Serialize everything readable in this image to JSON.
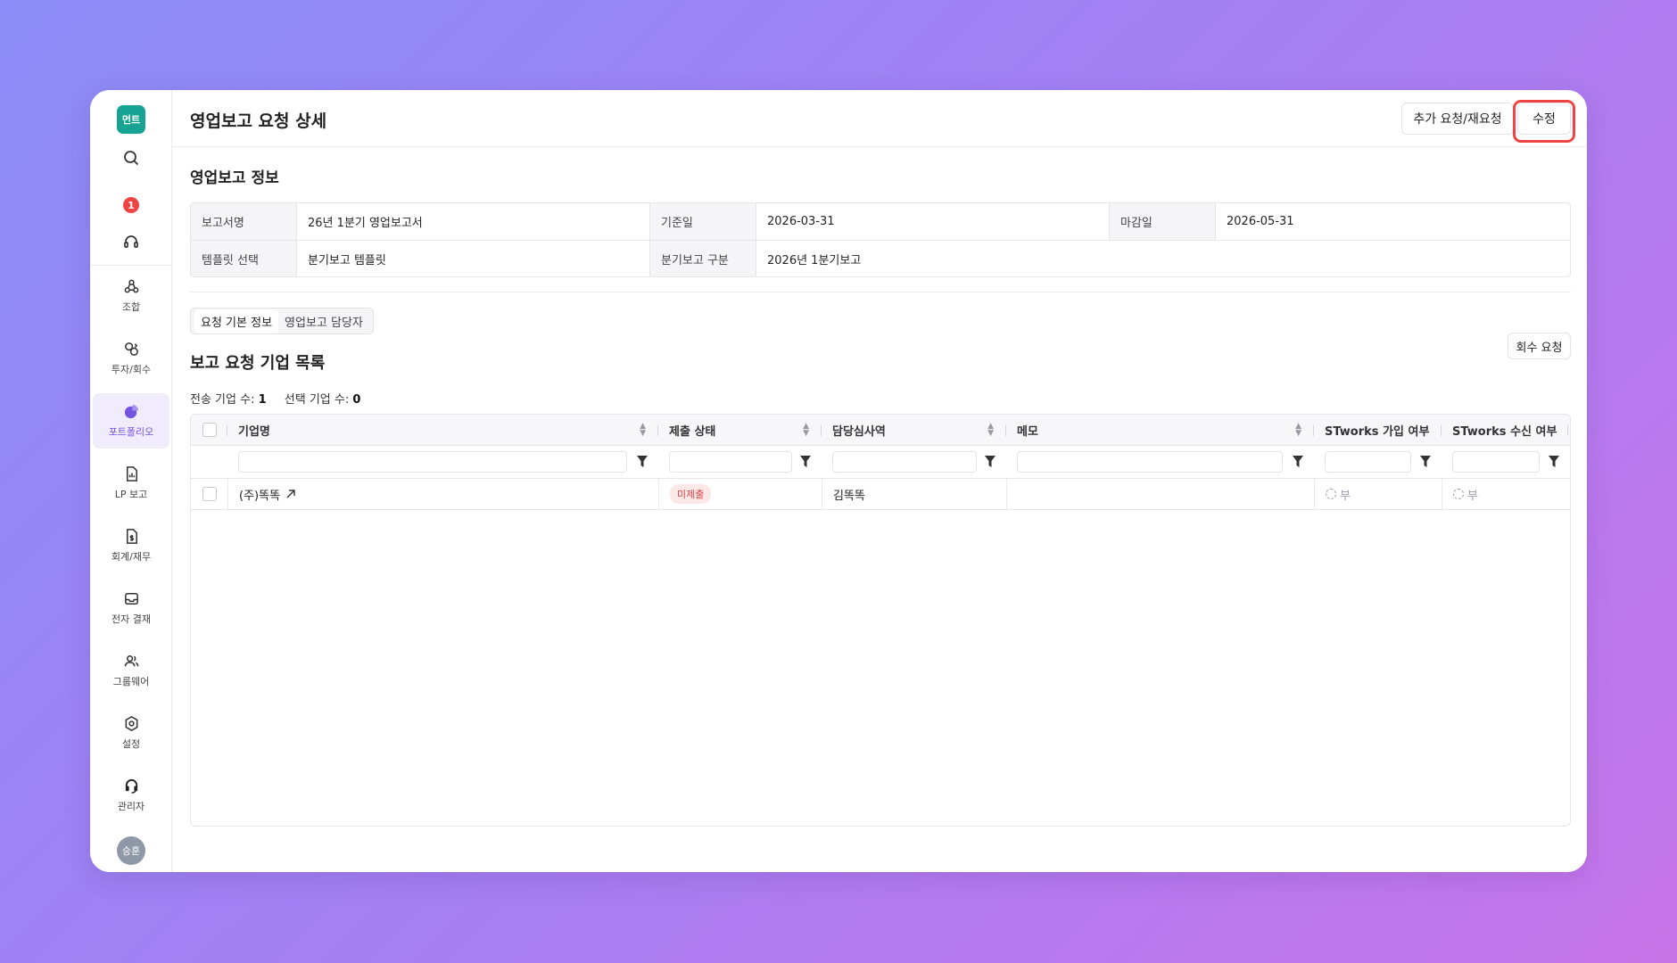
{
  "sidebar": {
    "logo": "먼트",
    "notification_count": "1",
    "items": [
      {
        "label": "조합"
      },
      {
        "label": "투자/회수"
      },
      {
        "label": "포트폴리오"
      },
      {
        "label": "LP 보고"
      },
      {
        "label": "회계/재무"
      },
      {
        "label": "전자 결재"
      },
      {
        "label": "그룹웨어"
      },
      {
        "label": "설정"
      },
      {
        "label": "관리자"
      }
    ],
    "avatar": "승훈"
  },
  "header": {
    "title": "영업보고 요청 상세",
    "extra_request_label": "추가 요청/재요청",
    "edit_label": "수정"
  },
  "info": {
    "section_title": "영업보고 정보",
    "report_name_label": "보고서명",
    "report_name": "26년 1분기 영업보고서",
    "base_date_label": "기준일",
    "base_date": "2026-03-31",
    "due_date_label": "마감일",
    "due_date": "2026-05-31",
    "template_label": "템플릿 선택",
    "template": "분기보고 템플릿",
    "quarter_label": "분기보고 구분",
    "quarter": "2026년 1분기보고"
  },
  "tabs": [
    "요청 기본 정보",
    "영업보고 담당자"
  ],
  "list": {
    "title": "보고 요청 기업 목록",
    "collect_label": "회수 요청",
    "sent_label": "전송 기업 수:",
    "sent_count": "1",
    "selected_label": "선택 기업 수:",
    "selected_count": "0",
    "columns": [
      "기업명",
      "제출 상태",
      "담당심사역",
      "메모",
      "STworks 가입 여부",
      "STworks 수신 여부"
    ],
    "rows": [
      {
        "name": "(주)똑똑",
        "status": "미제출",
        "owner": "김똑똑",
        "memo": "",
        "join": "부",
        "receive": "부"
      }
    ]
  }
}
